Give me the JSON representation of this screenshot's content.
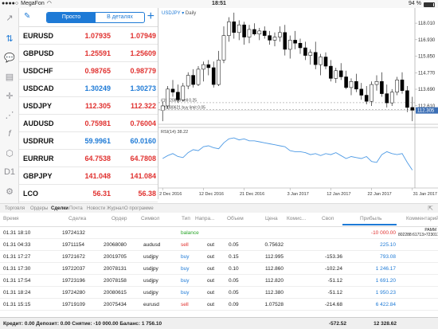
{
  "status_bar": {
    "carrier": "MegaFon",
    "time": "18:51",
    "battery": "94 %",
    "battery_level": 0.94
  },
  "quotes_header": {
    "segments": [
      "Просто",
      "В деталях"
    ],
    "active_segment": 0
  },
  "quotes": [
    {
      "symbol": "EURUSD",
      "bid": "1.07935",
      "ask": "1.07949",
      "color": "red"
    },
    {
      "symbol": "GBPUSD",
      "bid": "1.25591",
      "ask": "1.25609",
      "color": "red"
    },
    {
      "symbol": "USDCHF",
      "bid": "0.98765",
      "ask": "0.98779",
      "color": "red"
    },
    {
      "symbol": "USDCAD",
      "bid": "1.30249",
      "ask": "1.30273",
      "color": "blue"
    },
    {
      "symbol": "USDJPY",
      "bid": "112.305",
      "ask": "112.322",
      "color": "red"
    },
    {
      "symbol": "AUDUSD",
      "bid": "0.75981",
      "ask": "0.76004",
      "color": "red"
    },
    {
      "symbol": "USDRUR",
      "bid": "59.9961",
      "ask": "60.0160",
      "color": "blue"
    },
    {
      "symbol": "EURRUR",
      "bid": "64.7538",
      "ask": "64.7808",
      "color": "red"
    },
    {
      "symbol": "GBPJPY",
      "bid": "141.048",
      "ask": "141.084",
      "color": "red"
    },
    {
      "symbol": "LCO",
      "bid": "56.31",
      "ask": "56.38",
      "color": "red"
    }
  ],
  "left_toolbar": [
    "chart-up-icon",
    "arrows-icon",
    "chat-icon",
    "document-icon",
    "crosshair-icon",
    "indicator-icon",
    "function-icon",
    "objects-icon",
    "period-icon"
  ],
  "left_toolbar_labels": {
    "period": "D1"
  },
  "chart_data": [
    {
      "type": "candlestick",
      "title": "USDJPY",
      "timeframe": "Daily",
      "price_ticks": [
        "118.010",
        "116.930",
        "115.850",
        "114.770",
        "113.690",
        "112.610"
      ],
      "current_price_label": "112.305",
      "orders": [
        {
          "label": "#19720808 sell 0.25",
          "price": 112.81
        },
        {
          "label": "#20080621 buy limit 0.05",
          "price": 112.35
        }
      ],
      "x_tick_labels": [
        "2 Dec 2016",
        "12 Dec 2016",
        "21 Dec 2016",
        "3 Jan 2017",
        "12 Jan 2017",
        "22 Jan 2017",
        "31 Jan 2017"
      ],
      "ylim": [
        111.4,
        118.9
      ],
      "candles": [
        {
          "o": 112.3,
          "h": 112.9,
          "l": 111.6,
          "c": 112.6
        },
        {
          "o": 112.6,
          "h": 113.9,
          "l": 112.4,
          "c": 113.7
        },
        {
          "o": 113.7,
          "h": 114.3,
          "l": 113.2,
          "c": 113.5
        },
        {
          "o": 113.5,
          "h": 114.0,
          "l": 112.8,
          "c": 113.0
        },
        {
          "o": 113.0,
          "h": 114.1,
          "l": 112.9,
          "c": 113.9
        },
        {
          "o": 113.9,
          "h": 114.8,
          "l": 113.7,
          "c": 114.6
        },
        {
          "o": 114.6,
          "h": 115.0,
          "l": 113.8,
          "c": 114.0
        },
        {
          "o": 114.0,
          "h": 115.2,
          "l": 113.9,
          "c": 115.0
        },
        {
          "o": 115.0,
          "h": 115.5,
          "l": 114.2,
          "c": 115.3
        },
        {
          "o": 115.3,
          "h": 115.6,
          "l": 114.6,
          "c": 115.1
        },
        {
          "o": 115.1,
          "h": 115.5,
          "l": 113.8,
          "c": 114.0
        },
        {
          "o": 114.0,
          "h": 116.2,
          "l": 113.9,
          "c": 115.6
        },
        {
          "o": 115.6,
          "h": 117.8,
          "l": 115.4,
          "c": 117.2
        },
        {
          "o": 117.2,
          "h": 118.4,
          "l": 116.8,
          "c": 118.1
        },
        {
          "o": 118.1,
          "h": 118.7,
          "l": 117.0,
          "c": 117.4
        },
        {
          "o": 117.4,
          "h": 118.2,
          "l": 116.9,
          "c": 117.9
        },
        {
          "o": 117.9,
          "h": 118.1,
          "l": 116.6,
          "c": 117.1
        },
        {
          "o": 117.1,
          "h": 117.9,
          "l": 116.7,
          "c": 117.6
        },
        {
          "o": 117.6,
          "h": 118.0,
          "l": 117.2,
          "c": 117.3
        },
        {
          "o": 117.3,
          "h": 117.7,
          "l": 116.9,
          "c": 117.5
        },
        {
          "o": 117.5,
          "h": 117.8,
          "l": 117.0,
          "c": 117.2
        },
        {
          "o": 117.2,
          "h": 117.5,
          "l": 116.6,
          "c": 116.9
        },
        {
          "o": 116.9,
          "h": 117.4,
          "l": 116.5,
          "c": 117.1
        },
        {
          "o": 117.1,
          "h": 117.8,
          "l": 116.8,
          "c": 117.4
        },
        {
          "o": 117.4,
          "h": 117.9,
          "l": 115.9,
          "c": 116.3
        },
        {
          "o": 116.3,
          "h": 117.2,
          "l": 115.7,
          "c": 116.9
        },
        {
          "o": 116.9,
          "h": 117.5,
          "l": 116.3,
          "c": 116.7
        },
        {
          "o": 116.7,
          "h": 117.0,
          "l": 116.0,
          "c": 116.4
        },
        {
          "o": 116.4,
          "h": 116.8,
          "l": 115.6,
          "c": 115.9
        },
        {
          "o": 115.9,
          "h": 116.3,
          "l": 115.3,
          "c": 116.1
        },
        {
          "o": 116.1,
          "h": 116.8,
          "l": 115.0,
          "c": 115.3
        },
        {
          "o": 115.3,
          "h": 116.0,
          "l": 114.6,
          "c": 115.8
        },
        {
          "o": 115.8,
          "h": 116.1,
          "l": 115.0,
          "c": 115.2
        },
        {
          "o": 115.2,
          "h": 115.6,
          "l": 114.2,
          "c": 114.4
        },
        {
          "o": 114.4,
          "h": 115.1,
          "l": 114.1,
          "c": 114.9
        },
        {
          "o": 114.9,
          "h": 115.4,
          "l": 114.3,
          "c": 114.5
        },
        {
          "o": 114.5,
          "h": 114.9,
          "l": 113.7,
          "c": 113.8
        },
        {
          "o": 113.8,
          "h": 114.4,
          "l": 113.3,
          "c": 114.2
        },
        {
          "o": 114.2,
          "h": 114.7,
          "l": 113.5,
          "c": 113.7
        },
        {
          "o": 113.7,
          "h": 114.1,
          "l": 113.0,
          "c": 113.3
        },
        {
          "o": 113.3,
          "h": 113.9,
          "l": 112.7,
          "c": 112.9
        },
        {
          "o": 112.9,
          "h": 114.2,
          "l": 112.6,
          "c": 114.0
        },
        {
          "o": 114.0,
          "h": 114.6,
          "l": 113.6,
          "c": 114.2
        },
        {
          "o": 114.2,
          "h": 114.8,
          "l": 113.2,
          "c": 113.4
        },
        {
          "o": 113.4,
          "h": 114.0,
          "l": 112.5,
          "c": 112.8
        },
        {
          "o": 112.8,
          "h": 113.7,
          "l": 112.6,
          "c": 113.5
        },
        {
          "o": 113.5,
          "h": 114.5,
          "l": 113.3,
          "c": 114.3
        },
        {
          "o": 114.3,
          "h": 114.8,
          "l": 113.4,
          "c": 113.6
        },
        {
          "o": 113.6,
          "h": 113.9,
          "l": 112.2,
          "c": 112.5
        },
        {
          "o": 112.5,
          "h": 113.2,
          "l": 111.6,
          "c": 112.305
        }
      ],
      "rsi_label": "RSI(14) 38.22",
      "rsi_ylim": [
        20,
        80
      ],
      "rsi": [
        50,
        53,
        55,
        52,
        51,
        56,
        59,
        58,
        62,
        63,
        61,
        60,
        66,
        70,
        71,
        69,
        70,
        68,
        68,
        67,
        66,
        65,
        64,
        63,
        62,
        58,
        57,
        57,
        56,
        54,
        55,
        53,
        55,
        54,
        56,
        53,
        50,
        52,
        51,
        50,
        52,
        47,
        46,
        54,
        57,
        55,
        54,
        55,
        46,
        38.22
      ]
    }
  ],
  "bottom_tabs": [
    "Торговля",
    "Ордеры",
    "Сделки",
    "Почта",
    "Новости",
    "Журнал",
    "О программе"
  ],
  "active_tab": 2,
  "table": {
    "columns": [
      "Время",
      "Сделка",
      "Ордер",
      "Символ",
      "Тип",
      "Напра...",
      "Объем",
      "Цена",
      "Комис...",
      "Своп",
      "Прибыль",
      "Комментарий"
    ],
    "rows": [
      {
        "time": "01.31 18:10",
        "deal": "19724132",
        "order": "",
        "symbol": "",
        "type": "balance",
        "dir": "",
        "volume": "",
        "price": "",
        "commission": "",
        "swap": "",
        "profit": "-10 000.00",
        "comment": "PAMM\n802288:61713>723017",
        "profit_color": "red"
      },
      {
        "time": "01.31 04:33",
        "deal": "19711154",
        "order": "20068080",
        "symbol": "audusd",
        "type": "sell",
        "dir": "out",
        "volume": "0.05",
        "price": "0.75632",
        "commission": "",
        "swap": "",
        "profit": "225.10",
        "comment": "",
        "profit_color": "blue"
      },
      {
        "time": "01.31 17:27",
        "deal": "19721672",
        "order": "20019705",
        "symbol": "usdjpy",
        "type": "buy",
        "dir": "out",
        "volume": "0.15",
        "price": "112.995",
        "commission": "",
        "swap": "-153.36",
        "profit": "793.08",
        "comment": "",
        "profit_color": "blue"
      },
      {
        "time": "01.31 17:30",
        "deal": "19722037",
        "order": "20078131",
        "symbol": "usdjpy",
        "type": "buy",
        "dir": "out",
        "volume": "0.10",
        "price": "112.860",
        "commission": "",
        "swap": "-102.24",
        "profit": "1 246.17",
        "comment": "",
        "profit_color": "blue"
      },
      {
        "time": "01.31 17:54",
        "deal": "19723196",
        "order": "20078158",
        "symbol": "usdjpy",
        "type": "buy",
        "dir": "out",
        "volume": "0.05",
        "price": "112.820",
        "commission": "",
        "swap": "-51.12",
        "profit": "1 691.20",
        "comment": "",
        "profit_color": "blue"
      },
      {
        "time": "01.31 18:24",
        "deal": "19724280",
        "order": "20080615",
        "symbol": "usdjpy",
        "type": "buy",
        "dir": "out",
        "volume": "0.05",
        "price": "112.380",
        "commission": "",
        "swap": "-51.12",
        "profit": "1 950.23",
        "comment": "",
        "profit_color": "blue"
      },
      {
        "time": "01.31 15:15",
        "deal": "19719109",
        "order": "20075434",
        "symbol": "eurusd",
        "type": "sell",
        "dir": "out",
        "volume": "0.09",
        "price": "1.07528",
        "commission": "",
        "swap": "-214.68",
        "profit": "6 422.84",
        "comment": "",
        "profit_color": "blue"
      }
    ]
  },
  "footer": {
    "summary": "Кредит: 0.00 Депозит: 0.00 Снятие: -10 000.00 Баланс: 1 756.10",
    "swap_total": "-572.52",
    "profit_total": "12 328.62"
  },
  "colors": {
    "accent": "#1e7ad6",
    "bear": "#000000",
    "bull": "#ffffff",
    "rsi_line": "#4f9be5",
    "sell_red": "#e0312f",
    "balance_green": "#2aa52a"
  }
}
